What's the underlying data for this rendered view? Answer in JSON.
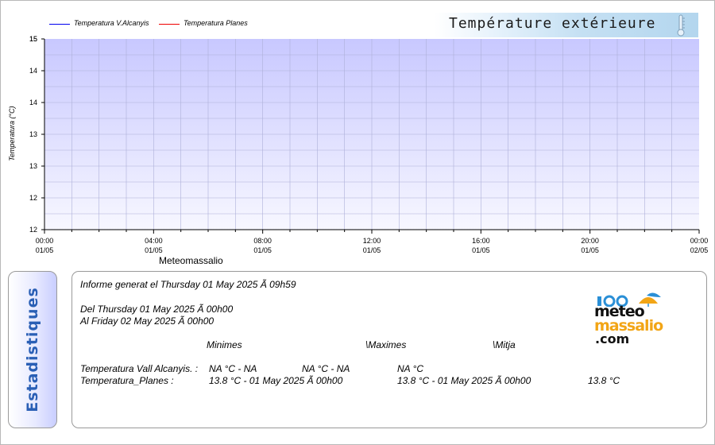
{
  "chart_data": {
    "type": "line",
    "title": "Température extérieure",
    "ylabel": "Temperatura (°C)",
    "xlabel": "",
    "subtitle": "Meteomassalio",
    "ylim": [
      12,
      15
    ],
    "yticks": [
      {
        "value": 12,
        "label": "12"
      },
      {
        "value": 12.5,
        "label": "12"
      },
      {
        "value": 13,
        "label": "13"
      },
      {
        "value": 13.5,
        "label": "13"
      },
      {
        "value": 14,
        "label": "14"
      },
      {
        "value": 14.5,
        "label": "14"
      },
      {
        "value": 15,
        "label": "15"
      },
      {
        "value": 15.5,
        "label": "15"
      }
    ],
    "xrange_hours": [
      0,
      24
    ],
    "xticks": [
      {
        "hour": 0,
        "time": "00:00",
        "date": "01/05"
      },
      {
        "hour": 4,
        "time": "04:00",
        "date": "01/05"
      },
      {
        "hour": 8,
        "time": "08:00",
        "date": "01/05"
      },
      {
        "hour": 12,
        "time": "12:00",
        "date": "01/05"
      },
      {
        "hour": 16,
        "time": "16:00",
        "date": "01/05"
      },
      {
        "hour": 20,
        "time": "20:00",
        "date": "01/05"
      },
      {
        "hour": 24,
        "time": "00:00",
        "date": "02/05"
      }
    ],
    "grid": true,
    "legend_position": "top-left",
    "series": [
      {
        "name": "Temperatura V.Alcanyis",
        "color": "#0000ee",
        "values": []
      },
      {
        "name": "Temperatura Planes",
        "color": "#ee0000",
        "values": []
      }
    ],
    "plot_colors": {
      "top": "#c8c8ff",
      "bottom": "#f7f7ff",
      "grid": "#aeb0d8"
    }
  },
  "stats": {
    "tab_label": "Estadistiques",
    "report_line": "Informe generat el Thursday 01 May 2025 Ã  09h59",
    "from_line": "Del Thursday 01 May 2025 Ã  00h00",
    "to_line": "Al Friday 02 May 2025 Ã  00h00",
    "headers": {
      "min": "Minimes",
      "max": "\\Maximes",
      "avg": "\\Mitja"
    },
    "rows": [
      {
        "label": "Temperatura Vall Alcanyis. :",
        "min": "NA °C - NA",
        "max": "NA °C - NA",
        "avg": "NA °C",
        "extra": ""
      },
      {
        "label": "Temperatura_Planes :",
        "min": "13.8 °C - 01 May 2025 Ã  00h00",
        "max": "",
        "avg": "13.8 °C - 01 May 2025 Ã  00h00",
        "extra": "13.8 °C"
      }
    ]
  },
  "logo": {
    "line1": "meteo",
    "line2": "massalio",
    "line3": ".com"
  }
}
